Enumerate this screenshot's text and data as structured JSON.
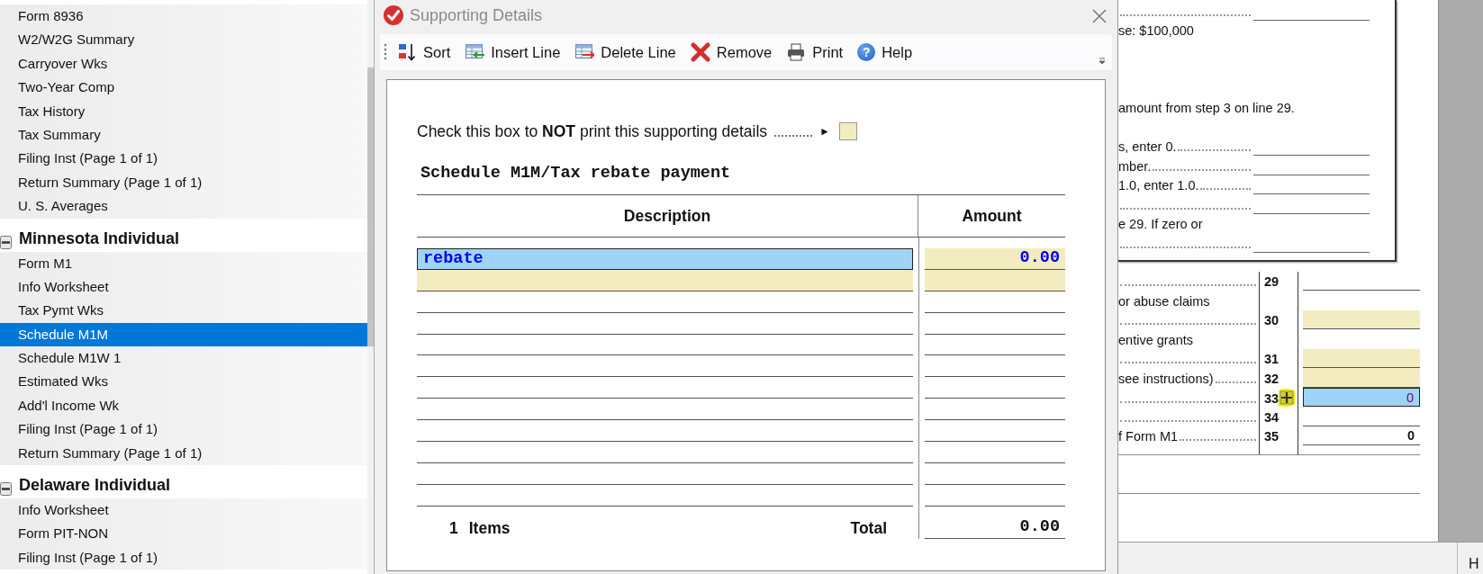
{
  "sidebar": {
    "items": [
      {
        "label": "Form 8936",
        "selected": false
      },
      {
        "label": "W2/W2G Summary",
        "selected": false
      },
      {
        "label": "Carryover Wks",
        "selected": false
      },
      {
        "label": "Two-Year Comp",
        "selected": false
      },
      {
        "label": "Tax History",
        "selected": false
      },
      {
        "label": "Tax Summary",
        "selected": false
      },
      {
        "label": "Filing Inst (Page 1 of 1)",
        "selected": false
      },
      {
        "label": "Return Summary (Page 1 of 1)",
        "selected": false
      },
      {
        "label": "U. S. Averages",
        "selected": false
      }
    ],
    "sections": [
      {
        "title": "Minnesota Individual",
        "expanded": true,
        "items": [
          {
            "label": "Form M1",
            "selected": false
          },
          {
            "label": "Info Worksheet",
            "selected": false
          },
          {
            "label": "Tax Pymt Wks",
            "selected": false
          },
          {
            "label": "Schedule M1M",
            "selected": true
          },
          {
            "label": "Schedule M1W 1",
            "selected": false
          },
          {
            "label": "Estimated Wks",
            "selected": false
          },
          {
            "label": "Add'l Income Wk",
            "selected": false
          },
          {
            "label": "Filing Inst (Page 1 of 1)",
            "selected": false
          },
          {
            "label": "Return Summary (Page 1 of 1)",
            "selected": false
          }
        ]
      },
      {
        "title": "Delaware Individual",
        "expanded": true,
        "items": [
          {
            "label": "Info Worksheet",
            "selected": false
          },
          {
            "label": "Form PIT-NON",
            "selected": false
          },
          {
            "label": "Filing Inst (Page 1 of 1)",
            "selected": false
          }
        ]
      }
    ]
  },
  "dialog": {
    "title": "Supporting Details",
    "toolbar": [
      {
        "label": "Sort",
        "kind": "sort"
      },
      {
        "label": "Insert Line",
        "kind": "insert-line"
      },
      {
        "label": "Delete Line",
        "kind": "delete-line"
      },
      {
        "label": "Remove",
        "kind": "remove"
      },
      {
        "label": "Print",
        "kind": "print"
      },
      {
        "label": "Help",
        "kind": "help",
        "glyph": "?"
      }
    ],
    "no_print": {
      "label": "Check this box to **NOT** print this supporting details",
      "arrow": "►",
      "checked": false
    },
    "heading": "Schedule M1M/Tax rebate payment",
    "columns": [
      "Description",
      "Amount"
    ],
    "rows": [
      {
        "kind": "active",
        "description": "rebate",
        "amount": "0.00"
      },
      {
        "kind": "input"
      },
      {
        "kind": "blank"
      },
      {
        "kind": "blank"
      },
      {
        "kind": "blank"
      },
      {
        "kind": "blank"
      },
      {
        "kind": "blank"
      },
      {
        "kind": "blank"
      },
      {
        "kind": "blank"
      },
      {
        "kind": "blank"
      },
      {
        "kind": "blank"
      },
      {
        "kind": "blank"
      }
    ],
    "footer": {
      "count": "1",
      "count_label": "Items",
      "total_label": "Total",
      "total": "0.00"
    }
  },
  "form_page": {
    "upper_rows": [
      {
        "kind": "line"
      },
      {
        "kind": "text",
        "text": "se: $100,000"
      },
      {
        "kind": "gap"
      },
      {
        "kind": "gap"
      },
      {
        "kind": "gap"
      },
      {
        "kind": "text",
        "text": "amount from step 3 on line 29."
      },
      {
        "kind": "gap"
      },
      {
        "kind": "line",
        "text": "s, enter 0."
      },
      {
        "kind": "line",
        "text": "mber."
      },
      {
        "kind": "line",
        "text": "1.0, enter 1.0."
      },
      {
        "kind": "line"
      },
      {
        "kind": "text",
        "text": "e 29. If zero or"
      },
      {
        "kind": "line"
      }
    ],
    "lines": [
      {
        "number": "29",
        "kind": "line"
      },
      {
        "text": "or abuse claims",
        "kind": "text"
      },
      {
        "number": "30",
        "kind": "input"
      },
      {
        "text": "entive grants",
        "kind": "text"
      },
      {
        "number": "31",
        "kind": "input"
      },
      {
        "text": "see instructions)",
        "number": "32",
        "kind": "input"
      },
      {
        "number": "33",
        "kind": "active",
        "value": "0",
        "cursor": true
      },
      {
        "number": "34",
        "kind": "line"
      },
      {
        "text": "f Form M1",
        "number": "35",
        "kind": "line",
        "value": "0"
      }
    ]
  },
  "status_bar": {
    "text": "H"
  }
}
